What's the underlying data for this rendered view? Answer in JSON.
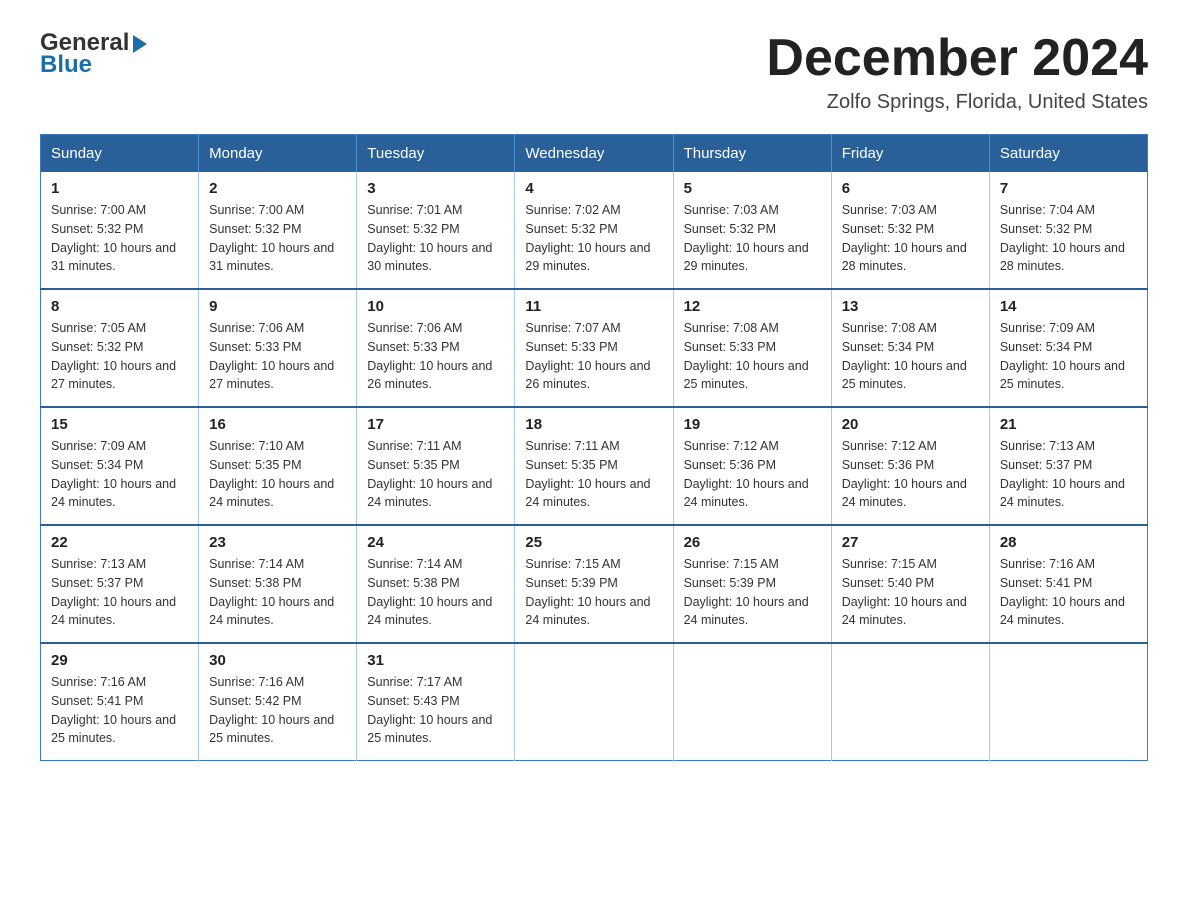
{
  "header": {
    "logo_general": "General",
    "logo_blue": "Blue",
    "month_title": "December 2024",
    "location": "Zolfo Springs, Florida, United States"
  },
  "weekdays": [
    "Sunday",
    "Monday",
    "Tuesday",
    "Wednesday",
    "Thursday",
    "Friday",
    "Saturday"
  ],
  "weeks": [
    [
      {
        "day": "1",
        "sunrise": "7:00 AM",
        "sunset": "5:32 PM",
        "daylight": "10 hours and 31 minutes."
      },
      {
        "day": "2",
        "sunrise": "7:00 AM",
        "sunset": "5:32 PM",
        "daylight": "10 hours and 31 minutes."
      },
      {
        "day": "3",
        "sunrise": "7:01 AM",
        "sunset": "5:32 PM",
        "daylight": "10 hours and 30 minutes."
      },
      {
        "day": "4",
        "sunrise": "7:02 AM",
        "sunset": "5:32 PM",
        "daylight": "10 hours and 29 minutes."
      },
      {
        "day": "5",
        "sunrise": "7:03 AM",
        "sunset": "5:32 PM",
        "daylight": "10 hours and 29 minutes."
      },
      {
        "day": "6",
        "sunrise": "7:03 AM",
        "sunset": "5:32 PM",
        "daylight": "10 hours and 28 minutes."
      },
      {
        "day": "7",
        "sunrise": "7:04 AM",
        "sunset": "5:32 PM",
        "daylight": "10 hours and 28 minutes."
      }
    ],
    [
      {
        "day": "8",
        "sunrise": "7:05 AM",
        "sunset": "5:32 PM",
        "daylight": "10 hours and 27 minutes."
      },
      {
        "day": "9",
        "sunrise": "7:06 AM",
        "sunset": "5:33 PM",
        "daylight": "10 hours and 27 minutes."
      },
      {
        "day": "10",
        "sunrise": "7:06 AM",
        "sunset": "5:33 PM",
        "daylight": "10 hours and 26 minutes."
      },
      {
        "day": "11",
        "sunrise": "7:07 AM",
        "sunset": "5:33 PM",
        "daylight": "10 hours and 26 minutes."
      },
      {
        "day": "12",
        "sunrise": "7:08 AM",
        "sunset": "5:33 PM",
        "daylight": "10 hours and 25 minutes."
      },
      {
        "day": "13",
        "sunrise": "7:08 AM",
        "sunset": "5:34 PM",
        "daylight": "10 hours and 25 minutes."
      },
      {
        "day": "14",
        "sunrise": "7:09 AM",
        "sunset": "5:34 PM",
        "daylight": "10 hours and 25 minutes."
      }
    ],
    [
      {
        "day": "15",
        "sunrise": "7:09 AM",
        "sunset": "5:34 PM",
        "daylight": "10 hours and 24 minutes."
      },
      {
        "day": "16",
        "sunrise": "7:10 AM",
        "sunset": "5:35 PM",
        "daylight": "10 hours and 24 minutes."
      },
      {
        "day": "17",
        "sunrise": "7:11 AM",
        "sunset": "5:35 PM",
        "daylight": "10 hours and 24 minutes."
      },
      {
        "day": "18",
        "sunrise": "7:11 AM",
        "sunset": "5:35 PM",
        "daylight": "10 hours and 24 minutes."
      },
      {
        "day": "19",
        "sunrise": "7:12 AM",
        "sunset": "5:36 PM",
        "daylight": "10 hours and 24 minutes."
      },
      {
        "day": "20",
        "sunrise": "7:12 AM",
        "sunset": "5:36 PM",
        "daylight": "10 hours and 24 minutes."
      },
      {
        "day": "21",
        "sunrise": "7:13 AM",
        "sunset": "5:37 PM",
        "daylight": "10 hours and 24 minutes."
      }
    ],
    [
      {
        "day": "22",
        "sunrise": "7:13 AM",
        "sunset": "5:37 PM",
        "daylight": "10 hours and 24 minutes."
      },
      {
        "day": "23",
        "sunrise": "7:14 AM",
        "sunset": "5:38 PM",
        "daylight": "10 hours and 24 minutes."
      },
      {
        "day": "24",
        "sunrise": "7:14 AM",
        "sunset": "5:38 PM",
        "daylight": "10 hours and 24 minutes."
      },
      {
        "day": "25",
        "sunrise": "7:15 AM",
        "sunset": "5:39 PM",
        "daylight": "10 hours and 24 minutes."
      },
      {
        "day": "26",
        "sunrise": "7:15 AM",
        "sunset": "5:39 PM",
        "daylight": "10 hours and 24 minutes."
      },
      {
        "day": "27",
        "sunrise": "7:15 AM",
        "sunset": "5:40 PM",
        "daylight": "10 hours and 24 minutes."
      },
      {
        "day": "28",
        "sunrise": "7:16 AM",
        "sunset": "5:41 PM",
        "daylight": "10 hours and 24 minutes."
      }
    ],
    [
      {
        "day": "29",
        "sunrise": "7:16 AM",
        "sunset": "5:41 PM",
        "daylight": "10 hours and 25 minutes."
      },
      {
        "day": "30",
        "sunrise": "7:16 AM",
        "sunset": "5:42 PM",
        "daylight": "10 hours and 25 minutes."
      },
      {
        "day": "31",
        "sunrise": "7:17 AM",
        "sunset": "5:43 PM",
        "daylight": "10 hours and 25 minutes."
      },
      null,
      null,
      null,
      null
    ]
  ]
}
